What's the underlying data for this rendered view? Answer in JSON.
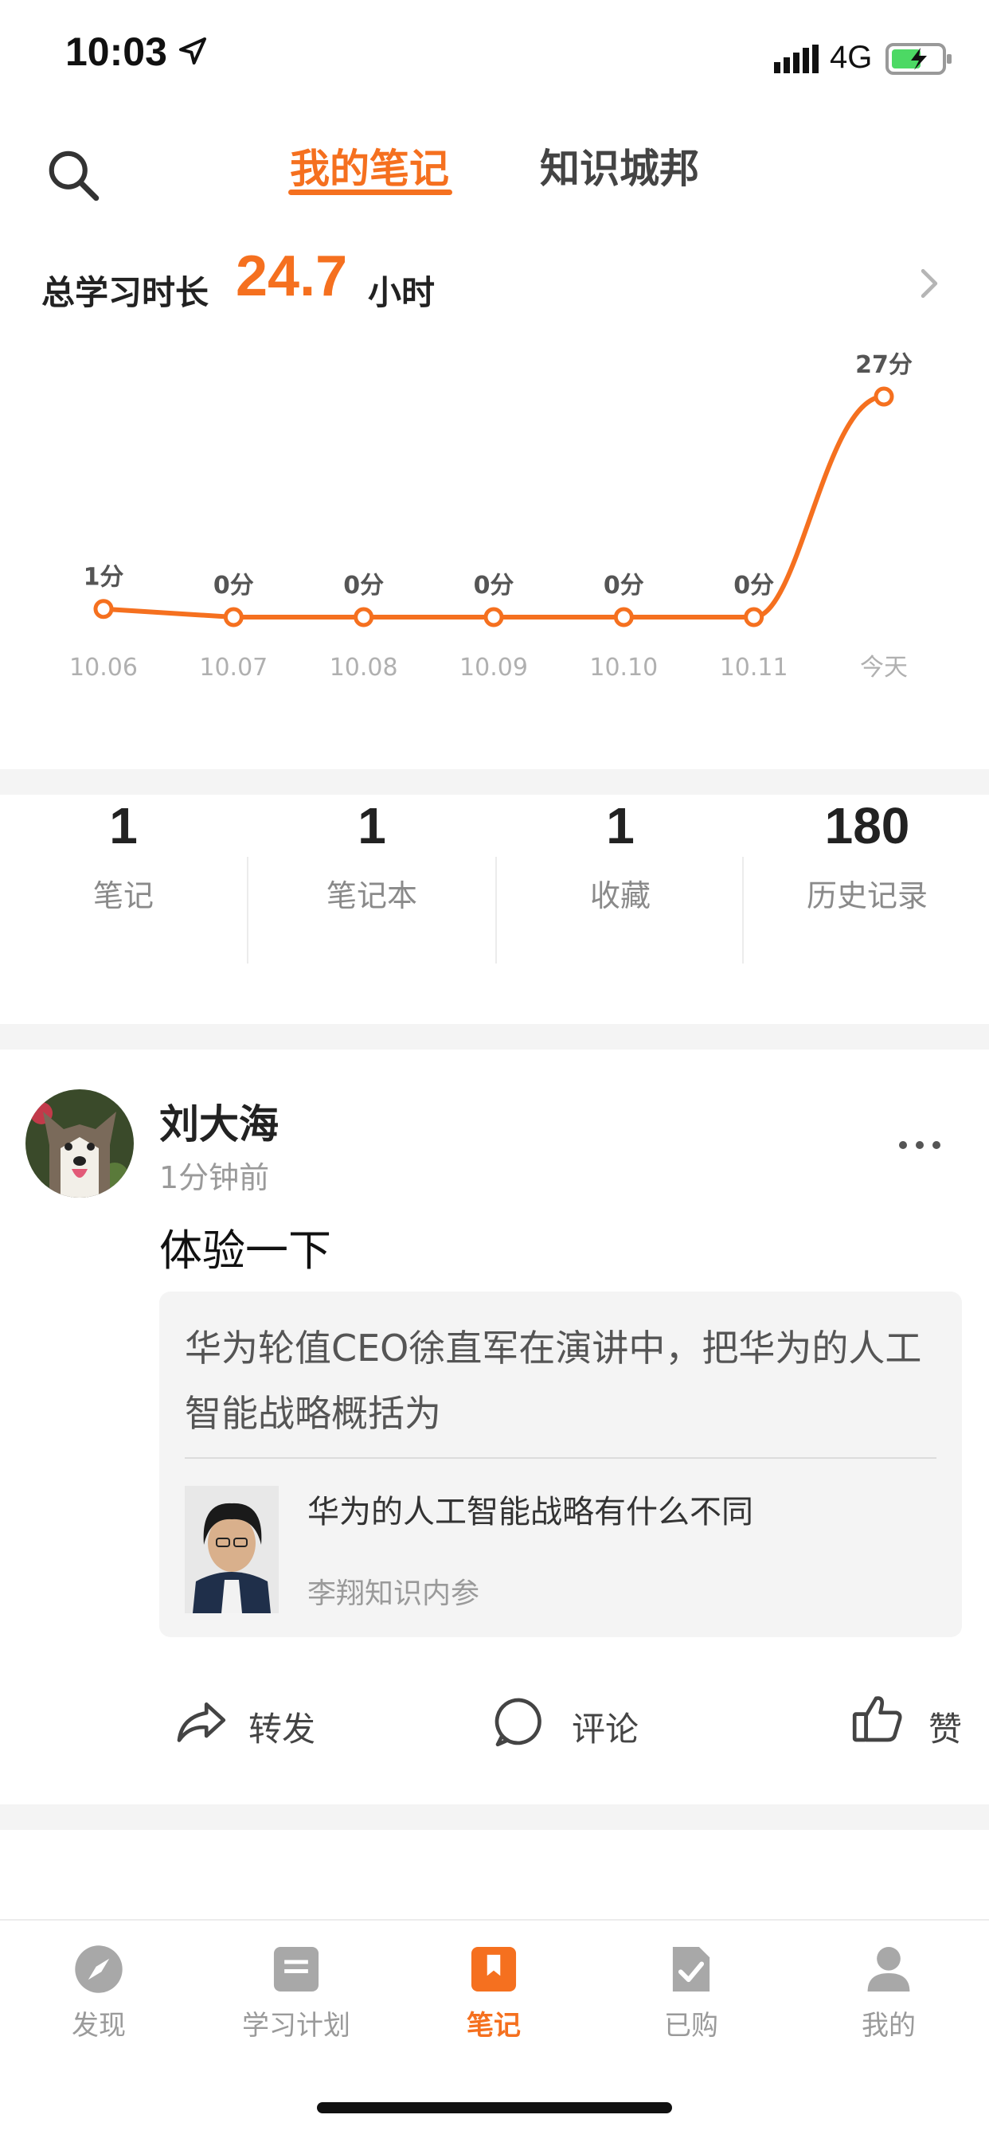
{
  "status_bar": {
    "time": "10:03",
    "network": "4G"
  },
  "header": {
    "tabs": [
      {
        "label": "我的笔记",
        "active": true
      },
      {
        "label": "知识城邦",
        "active": false
      }
    ]
  },
  "summary": {
    "label": "总学习时长",
    "value": "24.7",
    "unit": "小时"
  },
  "chart_data": {
    "type": "line",
    "categories": [
      "10.06",
      "10.07",
      "10.08",
      "10.09",
      "10.10",
      "10.11",
      "今天"
    ],
    "values": [
      1,
      0,
      0,
      0,
      0,
      0,
      27
    ],
    "data_labels": [
      "1分",
      "0分",
      "0分",
      "0分",
      "0分",
      "0分",
      "27分"
    ],
    "ylim": [
      0,
      27
    ],
    "color": "#f5701f",
    "grid": false
  },
  "stats": [
    {
      "value": "1",
      "label": "笔记"
    },
    {
      "value": "1",
      "label": "笔记本"
    },
    {
      "value": "1",
      "label": "收藏"
    },
    {
      "value": "180",
      "label": "历史记录"
    }
  ],
  "post": {
    "author": "刘大海",
    "time": "1分钟前",
    "content": "体验一下",
    "quote": "华为轮值CEO徐直军在演讲中，把华为的人工智能战略概括为",
    "article_title": "华为的人工智能战略有什么不同",
    "article_source": "李翔知识内参",
    "actions": {
      "share": "转发",
      "comment": "评论",
      "like": "赞"
    }
  },
  "nav": {
    "items": [
      {
        "label": "发现",
        "icon": "compass-icon",
        "active": false
      },
      {
        "label": "学习计划",
        "icon": "plan-icon",
        "active": false
      },
      {
        "label": "笔记",
        "icon": "bookmark-icon",
        "active": true
      },
      {
        "label": "已购",
        "icon": "purchased-icon",
        "active": false
      },
      {
        "label": "我的",
        "icon": "person-icon",
        "active": false
      }
    ]
  },
  "colors": {
    "accent": "#f5701f",
    "muted": "#9a9a9a"
  }
}
